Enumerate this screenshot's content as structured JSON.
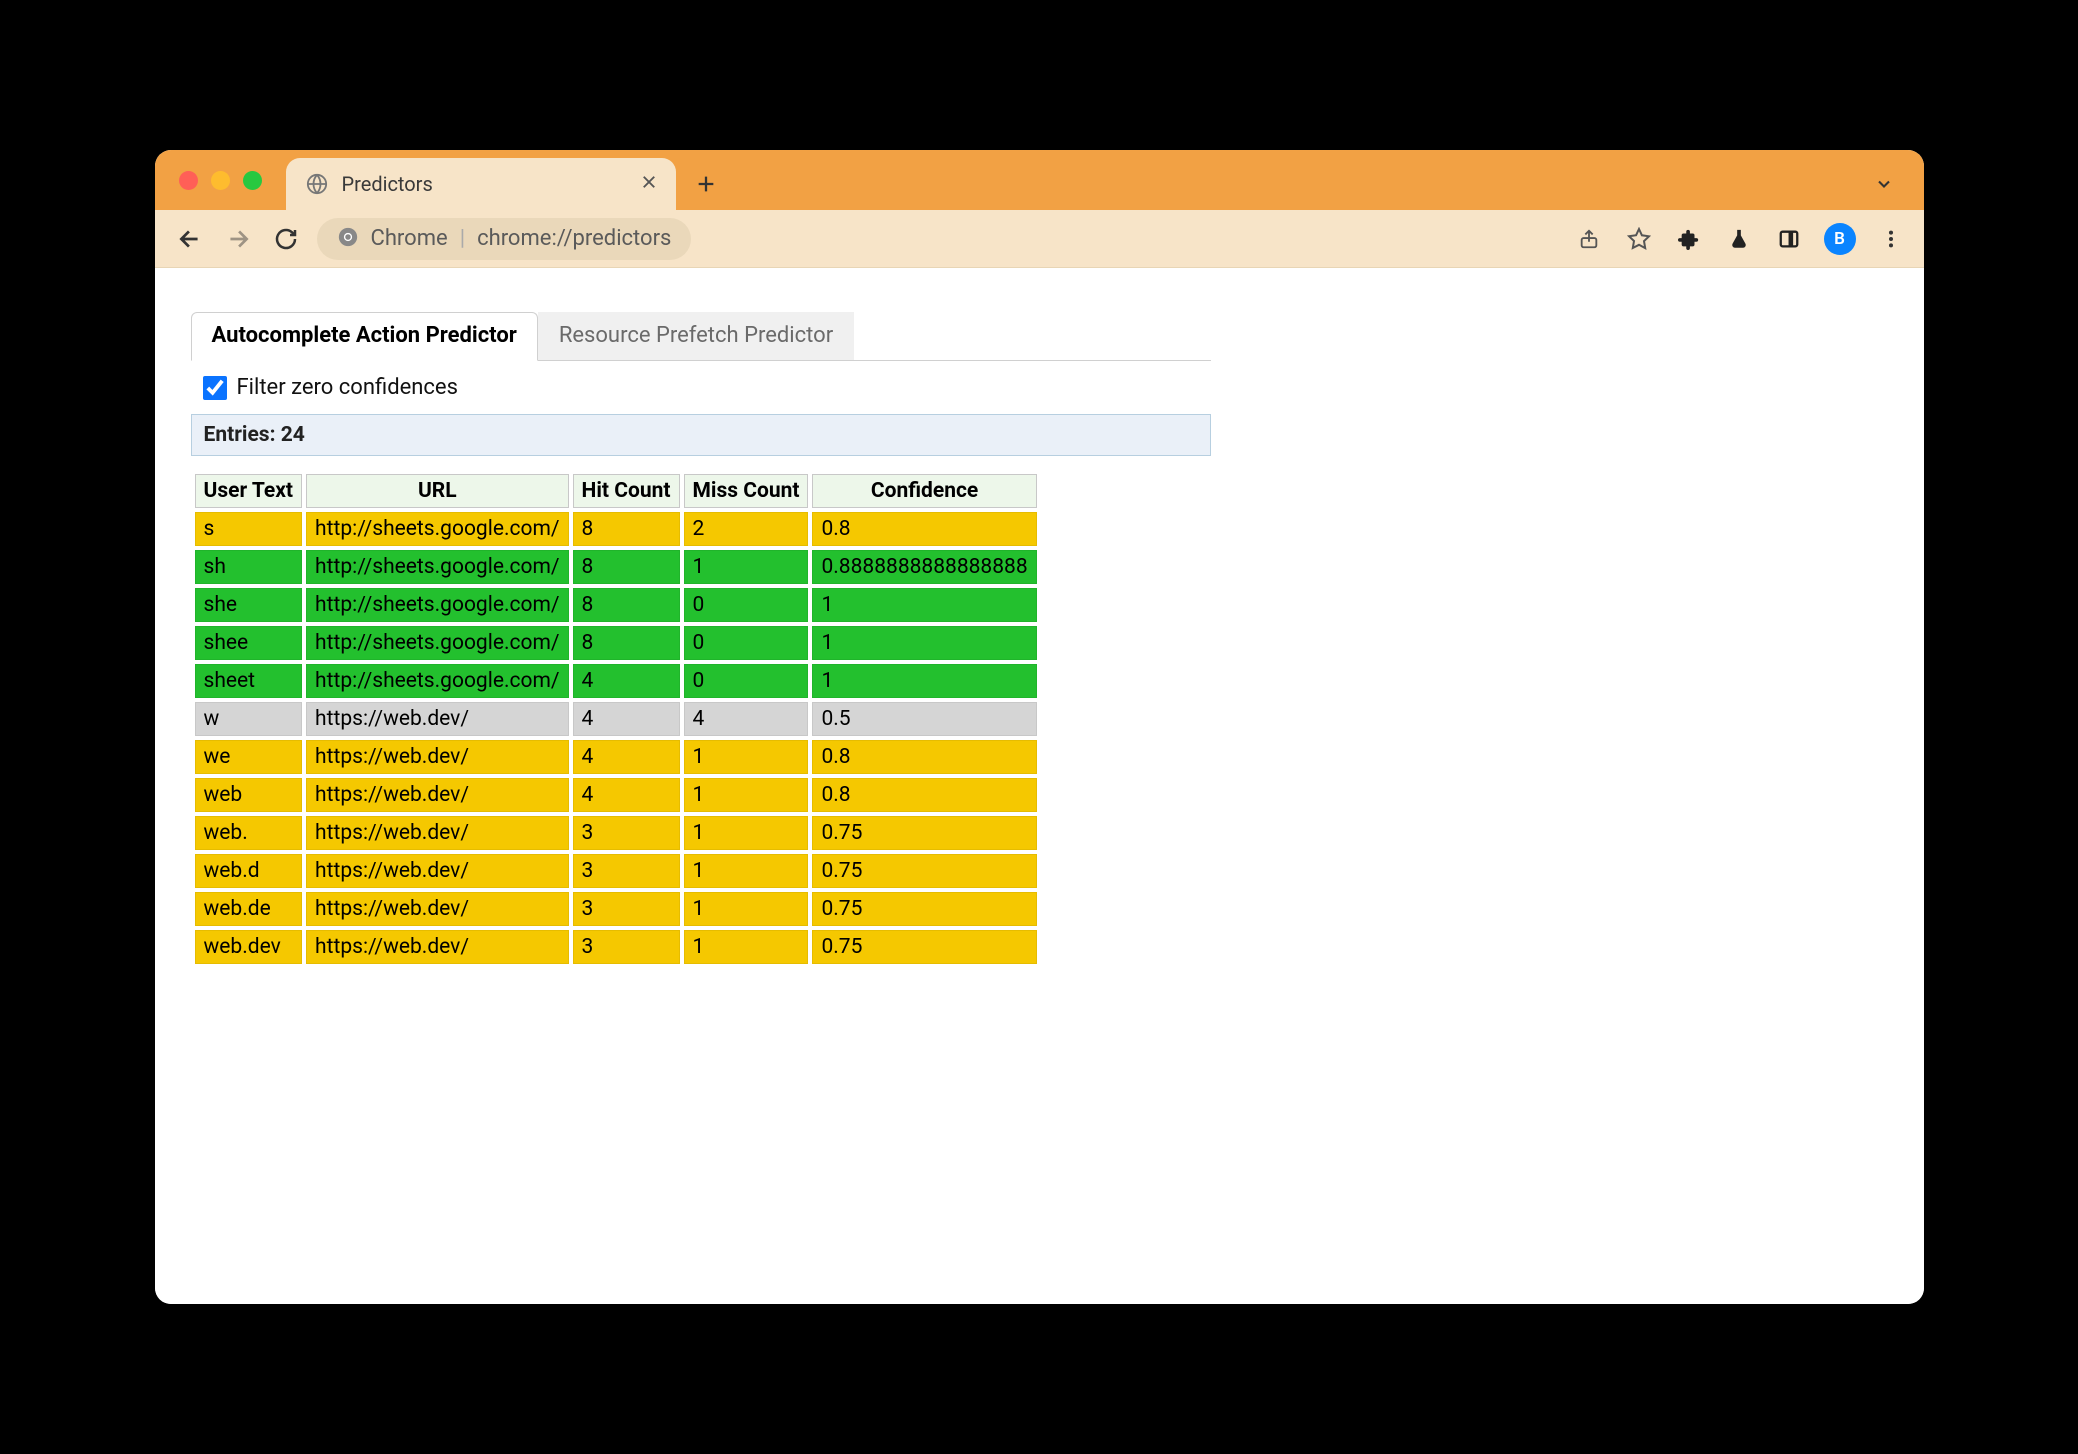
{
  "browser": {
    "tab_title": "Predictors",
    "omnibox": {
      "label": "Chrome",
      "url": "chrome://predictors"
    },
    "avatar_letter": "B"
  },
  "page": {
    "tabs": [
      {
        "label": "Autocomplete Action Predictor",
        "active": true
      },
      {
        "label": "Resource Prefetch Predictor",
        "active": false
      }
    ],
    "filter_label": "Filter zero confidences",
    "filter_checked": true,
    "entries_label": "Entries: 24",
    "columns": [
      "User Text",
      "URL",
      "Hit Count",
      "Miss Count",
      "Confidence"
    ],
    "rows": [
      {
        "user_text": "s",
        "url": "http://sheets.google.com/",
        "hit": "8",
        "miss": "2",
        "conf": "0.8",
        "color": "yellow"
      },
      {
        "user_text": "sh",
        "url": "http://sheets.google.com/",
        "hit": "8",
        "miss": "1",
        "conf": "0.8888888888888888",
        "color": "green"
      },
      {
        "user_text": "she",
        "url": "http://sheets.google.com/",
        "hit": "8",
        "miss": "0",
        "conf": "1",
        "color": "green"
      },
      {
        "user_text": "shee",
        "url": "http://sheets.google.com/",
        "hit": "8",
        "miss": "0",
        "conf": "1",
        "color": "green"
      },
      {
        "user_text": "sheet",
        "url": "http://sheets.google.com/",
        "hit": "4",
        "miss": "0",
        "conf": "1",
        "color": "green"
      },
      {
        "user_text": "w",
        "url": "https://web.dev/",
        "hit": "4",
        "miss": "4",
        "conf": "0.5",
        "color": "grey"
      },
      {
        "user_text": "we",
        "url": "https://web.dev/",
        "hit": "4",
        "miss": "1",
        "conf": "0.8",
        "color": "yellow"
      },
      {
        "user_text": "web",
        "url": "https://web.dev/",
        "hit": "4",
        "miss": "1",
        "conf": "0.8",
        "color": "yellow"
      },
      {
        "user_text": "web.",
        "url": "https://web.dev/",
        "hit": "3",
        "miss": "1",
        "conf": "0.75",
        "color": "yellow"
      },
      {
        "user_text": "web.d",
        "url": "https://web.dev/",
        "hit": "3",
        "miss": "1",
        "conf": "0.75",
        "color": "yellow"
      },
      {
        "user_text": "web.de",
        "url": "https://web.dev/",
        "hit": "3",
        "miss": "1",
        "conf": "0.75",
        "color": "yellow"
      },
      {
        "user_text": "web.dev",
        "url": "https://web.dev/",
        "hit": "3",
        "miss": "1",
        "conf": "0.75",
        "color": "yellow"
      }
    ]
  }
}
